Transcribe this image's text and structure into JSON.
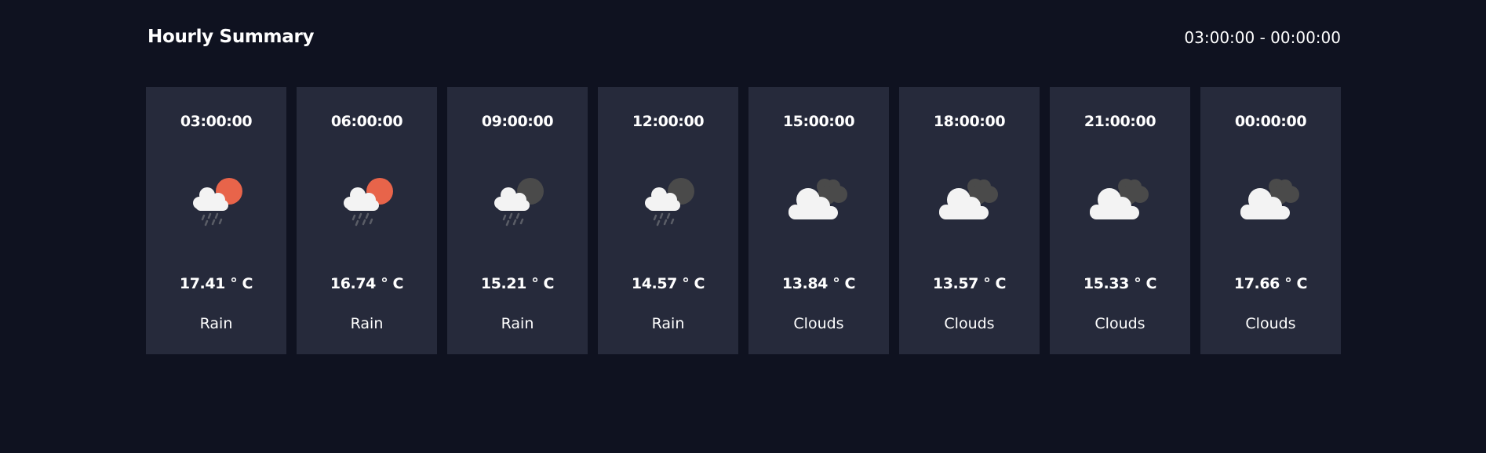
{
  "header": {
    "title": "Hourly Summary",
    "range": "03:00:00 - 00:00:00"
  },
  "cards": [
    {
      "time": "03:00:00",
      "temp": "17.41 ° C",
      "desc": "Rain",
      "icon": "rain-sun-icon",
      "sun_color": "#e8644a"
    },
    {
      "time": "06:00:00",
      "temp": "16.74 ° C",
      "desc": "Rain",
      "icon": "rain-sun-icon",
      "sun_color": "#e8644a"
    },
    {
      "time": "09:00:00",
      "temp": "15.21 ° C",
      "desc": "Rain",
      "icon": "rain-moon-icon",
      "sun_color": "#4a4a4a"
    },
    {
      "time": "12:00:00",
      "temp": "14.57 ° C",
      "desc": "Rain",
      "icon": "rain-moon-icon",
      "sun_color": "#4a4a4a"
    },
    {
      "time": "15:00:00",
      "temp": "13.84 ° C",
      "desc": "Clouds",
      "icon": "clouds-icon",
      "sun_color": "#4a4a4a"
    },
    {
      "time": "18:00:00",
      "temp": "13.57 ° C",
      "desc": "Clouds",
      "icon": "clouds-icon",
      "sun_color": "#4a4a4a"
    },
    {
      "time": "21:00:00",
      "temp": "15.33 ° C",
      "desc": "Clouds",
      "icon": "clouds-icon",
      "sun_color": "#4a4a4a"
    },
    {
      "time": "00:00:00",
      "temp": "17.66 ° C",
      "desc": "Clouds",
      "icon": "clouds-icon",
      "sun_color": "#4a4a4a"
    }
  ]
}
